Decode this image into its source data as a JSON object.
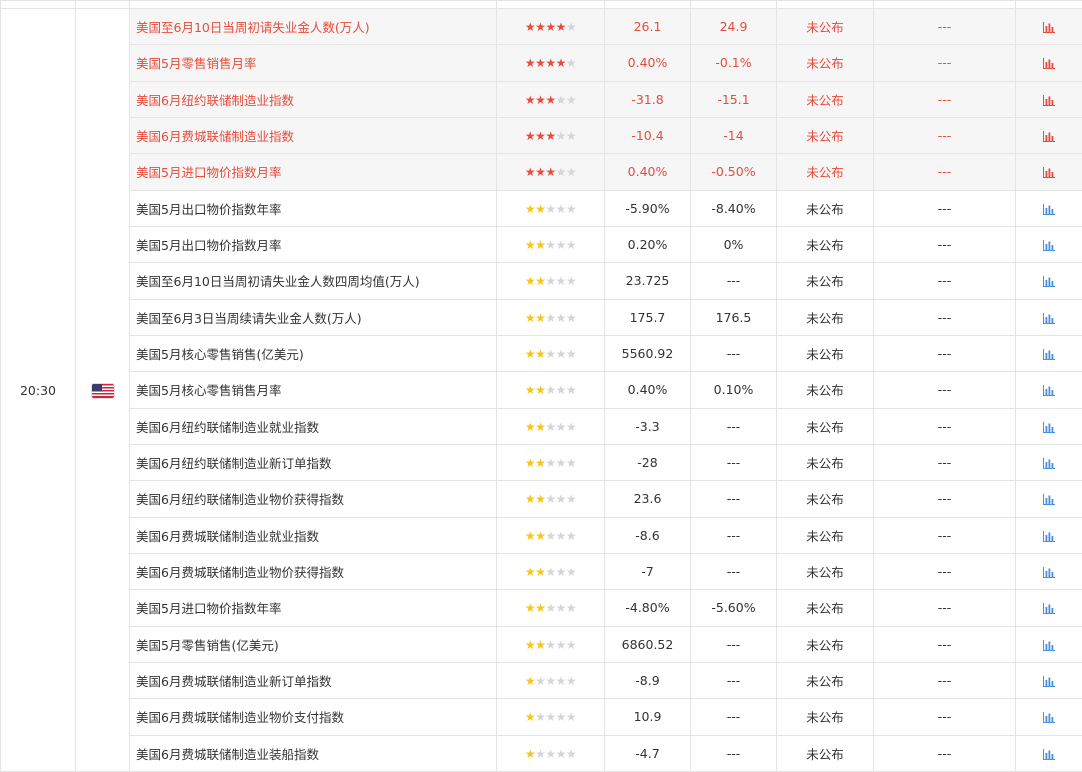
{
  "slot": {
    "time": "20:30",
    "country_flag": "us-flag-icon"
  },
  "colors": {
    "highlight_text": "#e74c3c",
    "star_on": "#f5c518",
    "star_off": "#d5d5d5",
    "chart_icon": "#4a90e2"
  },
  "rows": [
    {
      "event": "美国至6月10日当周初请失业金人数(万人)",
      "stars": 4,
      "previous": "26.1",
      "forecast": "24.9",
      "actual": "未公布",
      "impact": "---",
      "highlight": true
    },
    {
      "event": "美国5月零售销售月率",
      "stars": 4,
      "previous": "0.40%",
      "forecast": "-0.1%",
      "actual": "未公布",
      "impact": "---",
      "highlight": true
    },
    {
      "event": "美国6月纽约联储制造业指数",
      "stars": 3,
      "previous": "-31.8",
      "forecast": "-15.1",
      "actual": "未公布",
      "impact": "---",
      "highlight": true
    },
    {
      "event": "美国6月费城联储制造业指数",
      "stars": 3,
      "previous": "-10.4",
      "forecast": "-14",
      "actual": "未公布",
      "impact": "---",
      "highlight": true
    },
    {
      "event": "美国5月进口物价指数月率",
      "stars": 3,
      "previous": "0.40%",
      "forecast": "-0.50%",
      "actual": "未公布",
      "impact": "---",
      "highlight": true
    },
    {
      "event": "美国5月出口物价指数年率",
      "stars": 2,
      "previous": "-5.90%",
      "forecast": "-8.40%",
      "actual": "未公布",
      "impact": "---",
      "highlight": false
    },
    {
      "event": "美国5月出口物价指数月率",
      "stars": 2,
      "previous": "0.20%",
      "forecast": "0%",
      "actual": "未公布",
      "impact": "---",
      "highlight": false
    },
    {
      "event": "美国至6月10日当周初请失业金人数四周均值(万人)",
      "stars": 2,
      "previous": "23.725",
      "forecast": "---",
      "actual": "未公布",
      "impact": "---",
      "highlight": false
    },
    {
      "event": "美国至6月3日当周续请失业金人数(万人)",
      "stars": 2,
      "previous": "175.7",
      "forecast": "176.5",
      "actual": "未公布",
      "impact": "---",
      "highlight": false
    },
    {
      "event": "美国5月核心零售销售(亿美元)",
      "stars": 2,
      "previous": "5560.92",
      "forecast": "---",
      "actual": "未公布",
      "impact": "---",
      "highlight": false
    },
    {
      "event": "美国5月核心零售销售月率",
      "stars": 2,
      "previous": "0.40%",
      "forecast": "0.10%",
      "actual": "未公布",
      "impact": "---",
      "highlight": false
    },
    {
      "event": "美国6月纽约联储制造业就业指数",
      "stars": 2,
      "previous": "-3.3",
      "forecast": "---",
      "actual": "未公布",
      "impact": "---",
      "highlight": false
    },
    {
      "event": "美国6月纽约联储制造业新订单指数",
      "stars": 2,
      "previous": "-28",
      "forecast": "---",
      "actual": "未公布",
      "impact": "---",
      "highlight": false
    },
    {
      "event": "美国6月纽约联储制造业物价获得指数",
      "stars": 2,
      "previous": "23.6",
      "forecast": "---",
      "actual": "未公布",
      "impact": "---",
      "highlight": false
    },
    {
      "event": "美国6月费城联储制造业就业指数",
      "stars": 2,
      "previous": "-8.6",
      "forecast": "---",
      "actual": "未公布",
      "impact": "---",
      "highlight": false
    },
    {
      "event": "美国6月费城联储制造业物价获得指数",
      "stars": 2,
      "previous": "-7",
      "forecast": "---",
      "actual": "未公布",
      "impact": "---",
      "highlight": false
    },
    {
      "event": "美国5月进口物价指数年率",
      "stars": 2,
      "previous": "-4.80%",
      "forecast": "-5.60%",
      "actual": "未公布",
      "impact": "---",
      "highlight": false
    },
    {
      "event": "美国5月零售销售(亿美元)",
      "stars": 2,
      "previous": "6860.52",
      "forecast": "---",
      "actual": "未公布",
      "impact": "---",
      "highlight": false
    },
    {
      "event": "美国6月费城联储制造业新订单指数",
      "stars": 1,
      "previous": "-8.9",
      "forecast": "---",
      "actual": "未公布",
      "impact": "---",
      "highlight": false
    },
    {
      "event": "美国6月费城联储制造业物价支付指数",
      "stars": 1,
      "previous": "10.9",
      "forecast": "---",
      "actual": "未公布",
      "impact": "---",
      "highlight": false
    },
    {
      "event": "美国6月费城联储制造业装船指数",
      "stars": 1,
      "previous": "-4.7",
      "forecast": "---",
      "actual": "未公布",
      "impact": "---",
      "highlight": false
    }
  ]
}
